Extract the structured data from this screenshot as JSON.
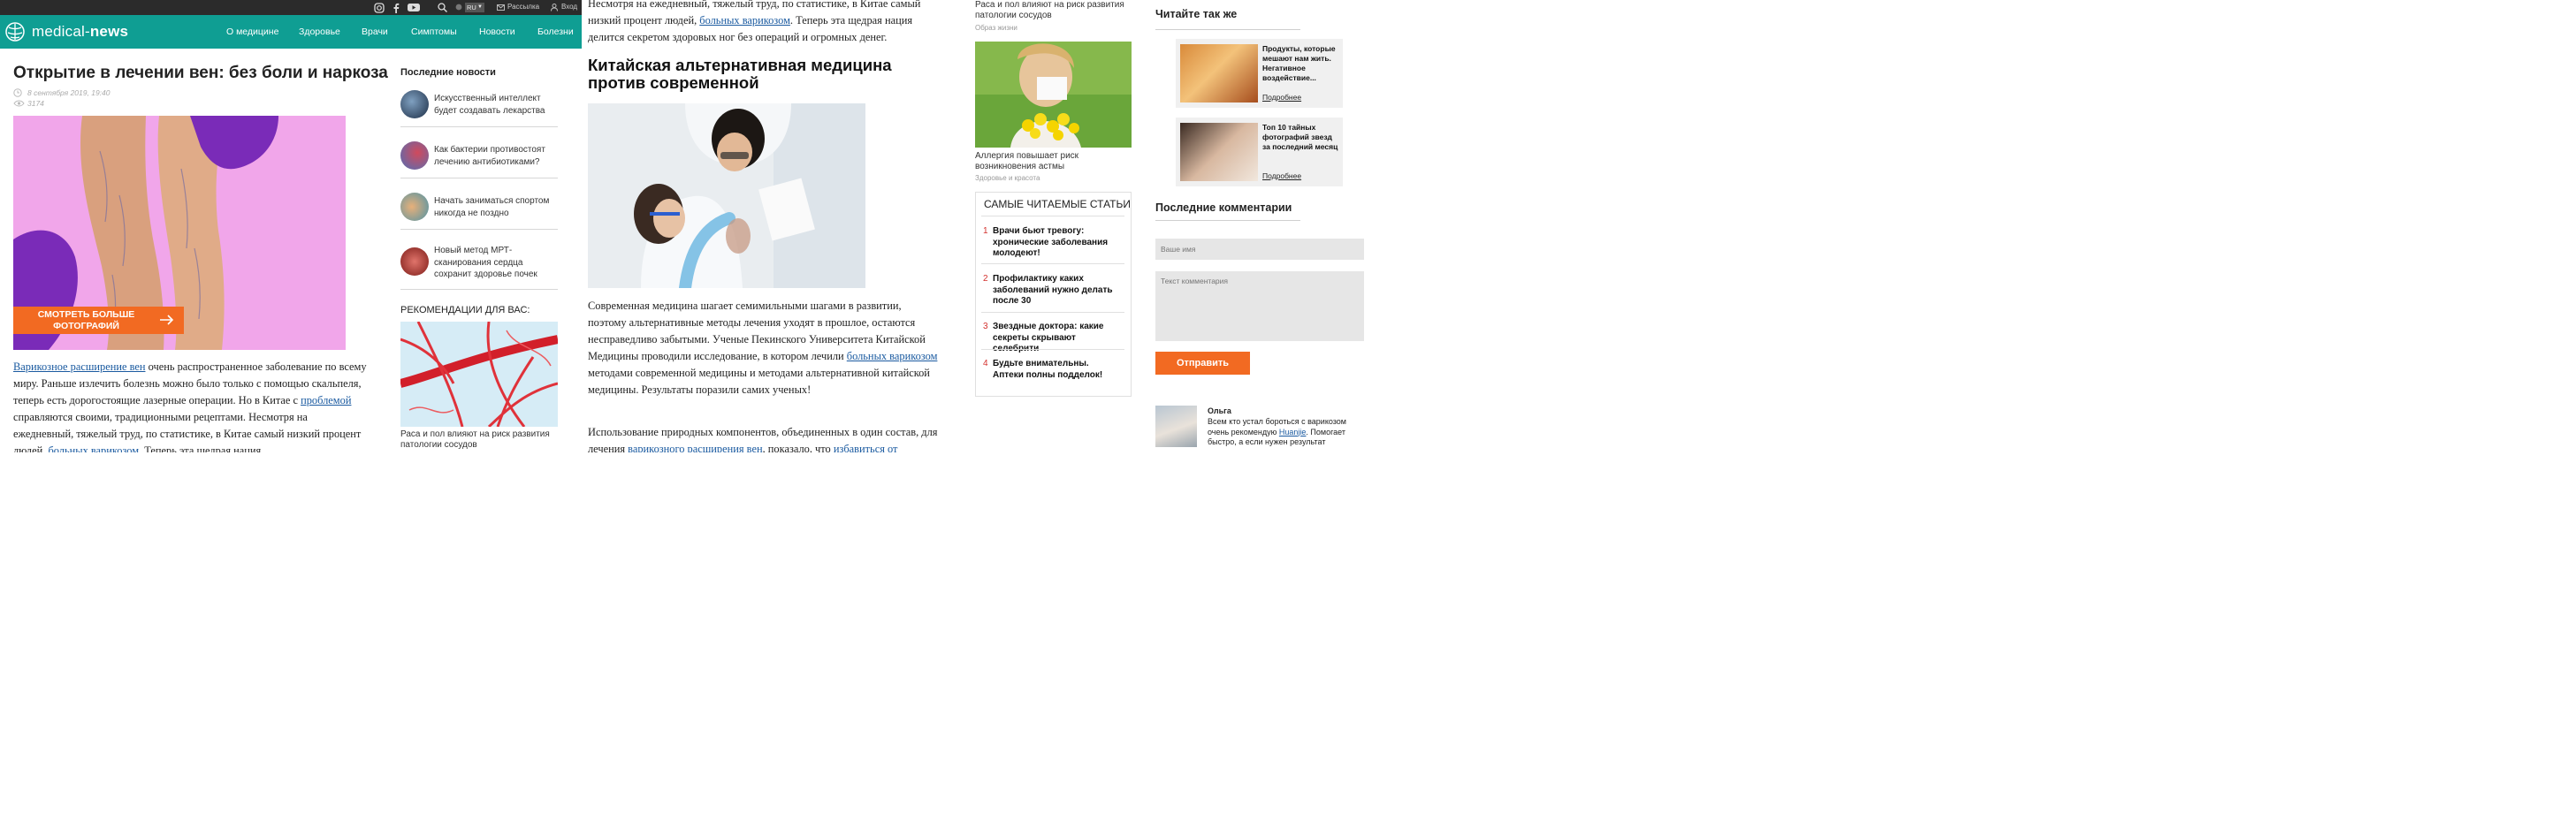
{
  "header": {
    "logo_text_a": "medical-",
    "logo_text_b": "news",
    "lang": "RU",
    "newsletter": "Рассылка",
    "login": "Вход",
    "nav": [
      "О медицине",
      "Здоровье",
      "Врачи",
      "Симптомы",
      "Новости",
      "Болезни"
    ]
  },
  "article": {
    "title": "Открытие в лечении вен: без боли и наркоза",
    "date": "8 сентября 2019, 19:40",
    "views": "3174",
    "photo_button": [
      "СМОТРЕТЬ БОЛЬШЕ",
      "ФОТОГРАФИЙ"
    ],
    "p1_link1": "Варикозное расширение вен",
    "p1_text1": " очень распространенное заболевание по всему миру. Раньше излечить болезнь можно было только с помощью скальпеля, теперь есть дорогостоящие лазерные операции. Но в Китае с ",
    "p1_link2": "проблемой",
    "p1_text2": " справляются своими, традиционными рецептами. Несмотря на ежедневный, тяжелый труд, по статистике, в Китае самый низкий процент людей, ",
    "p1_link3": "больных варикозом",
    "p1_text3": ". Теперь эта щедрая нация",
    "col2_p1_a": "Несмотря на ежедневный, тяжелый труд, по статистике, в Китае самый низкий процент людей, ",
    "col2_p1_link": "больных варикозом",
    "col2_p1_b": ". Теперь эта щедрая нация делится секретом здоровых ног без операций и огромных денег.",
    "h2": "Китайская альтернативная медицина против современной",
    "p2_a": "Современная медицина шагает семимильными шагами в развитии, поэтому альтернативные методы лечения уходят в прошлое, остаются несправедливо забытыми. Ученые Пекинского Университета Китайской Медицины проводили исследование, в котором лечили ",
    "p2_link": "больных варикозом",
    "p2_b": " методами современной медицины и методами альтернативной китайской медицины. Результаты поразили самих ученых!",
    "p3_a": "Использование природных компонентов, объединенных в один состав, для лечения ",
    "p3_link1": "варикозного расширения вен",
    "p3_b": ", показало, что ",
    "p3_link2": "избавиться от"
  },
  "latest_news": {
    "heading": "Последние новости",
    "items": [
      "Искусственный интеллект будет создавать лекарства",
      "Как бактерии противостоят лечению антибиотиками?",
      "Начать заниматься спортом никогда не поздно",
      "Новый метод МРТ-сканирования сердца сохранит здоровье почек"
    ]
  },
  "recommend": {
    "heading": "РЕКОМЕНДАЦИИ ДЛЯ ВАС:",
    "card1_title": "Раса и пол влияют на риск развития патологии сосудов",
    "card1_cat": "Образ жизни",
    "card2_title": "Аллергия повышает риск возникновения астмы",
    "card2_cat": "Здоровье и красота"
  },
  "most_read": {
    "heading": "САМЫЕ ЧИТАЕМЫЕ СТАТЬИ",
    "items": [
      {
        "num": "1",
        "title": "Врачи бьют тревогу: хронические заболевания молодеют!"
      },
      {
        "num": "2",
        "title": "Профилактику каких заболеваний нужно делать после 30"
      },
      {
        "num": "3",
        "title": "Звездные доктора: какие секреты скрывают селебрити"
      },
      {
        "num": "4",
        "title": "Будьте внимательны. Аптеки полны подделок!"
      }
    ]
  },
  "read_also": {
    "heading": "Читайте так же",
    "items": [
      {
        "title": "Продукты, которые мешают нам жить. Негативное воздействие...",
        "more": "Подробнее"
      },
      {
        "title": "Топ 10 тайных фотографий звезд за последний месяц",
        "more": "Подробнее"
      }
    ]
  },
  "comments": {
    "heading": "Последние комментарии",
    "name_placeholder": "Ваше имя",
    "text_placeholder": "Текст комментария",
    "submit": "Отправить",
    "author": "Ольга",
    "comment_a": "Всем кто устал бороться с варикозом очень рекомендую ",
    "comment_link": "Huanjie",
    "comment_b": ". Помогает быстро, а если нужен результат"
  },
  "colors": {
    "teal": "#0f9e93",
    "orange": "#f26a22",
    "link": "#1a5aa0",
    "number": "#d3312e"
  },
  "icons": [
    "instagram-icon",
    "facebook-icon",
    "youtube-icon",
    "search-icon",
    "globe-icon",
    "mail-icon",
    "user-icon",
    "logo-icon",
    "clock-icon",
    "eye-icon",
    "arrow-right-icon"
  ]
}
